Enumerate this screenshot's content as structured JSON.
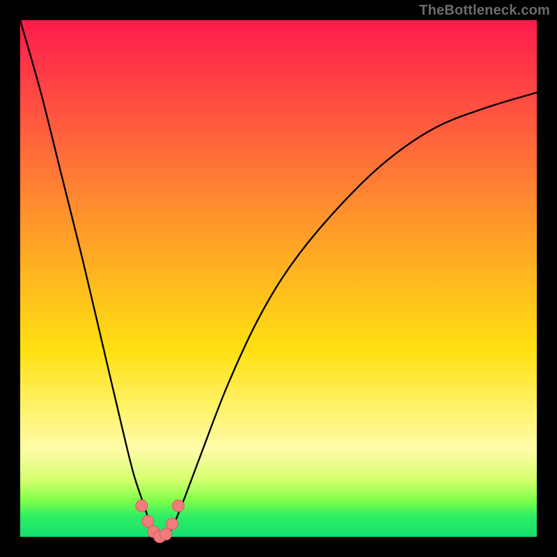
{
  "watermark": "TheBottleneck.com",
  "colors": {
    "background": "#000000",
    "curve": "#000000",
    "marker_fill": "#f07c7c",
    "marker_stroke": "#d65d5d",
    "gradient_stops": [
      "#ff1a4a",
      "#ff2e49",
      "#ff5a3f",
      "#ff8a2f",
      "#ffb81f",
      "#ffe012",
      "#fff26a",
      "#fffca8",
      "#d5ff6e",
      "#7fff4a",
      "#2fee63",
      "#14e06f"
    ]
  },
  "chart_data": {
    "type": "line",
    "title": "",
    "xlabel": "",
    "ylabel": "",
    "xlim": [
      0,
      100
    ],
    "ylim": [
      0,
      100
    ],
    "series": [
      {
        "name": "bottleneck-curve",
        "x": [
          0,
          4,
          8,
          12,
          16,
          20,
          22,
          24,
          25,
          26,
          27,
          28,
          29,
          30,
          32,
          35,
          40,
          46,
          52,
          60,
          70,
          80,
          90,
          100
        ],
        "values": [
          100,
          86,
          70,
          54,
          37,
          20,
          12,
          6,
          3,
          1,
          0,
          0,
          1,
          3,
          8,
          16,
          29,
          42,
          52,
          62,
          72,
          79,
          83,
          86
        ]
      }
    ],
    "markers": {
      "name": "valley-markers",
      "x": [
        23.5,
        24.7,
        25.8,
        27.0,
        28.2,
        29.4,
        30.6
      ],
      "values": [
        6.0,
        3.0,
        1.0,
        0.0,
        0.5,
        2.5,
        6.0
      ]
    },
    "grid": false,
    "legend": false
  }
}
